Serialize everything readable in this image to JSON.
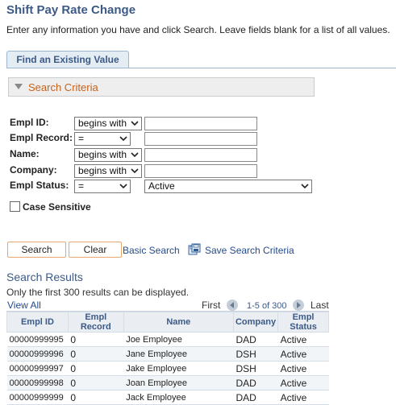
{
  "page": {
    "title": "Shift Pay Rate Change",
    "instructions": "Enter any information you have and click Search. Leave fields blank for a list of all values."
  },
  "tabs": [
    {
      "label": "Find an Existing Value"
    }
  ],
  "search_criteria": {
    "header": "Search Criteria",
    "fields": {
      "empl_id": {
        "label": "Empl ID:",
        "operator": "begins with",
        "value": ""
      },
      "empl_record": {
        "label": "Empl Record:",
        "operator": "=",
        "value": ""
      },
      "name": {
        "label": "Name:",
        "operator": "begins with",
        "value": ""
      },
      "company": {
        "label": "Company:",
        "operator": "begins with",
        "value": ""
      },
      "empl_status": {
        "label": "Empl Status:",
        "operator": "=",
        "value": "Active"
      }
    },
    "case_sensitive": {
      "label": "Case Sensitive",
      "checked": false
    }
  },
  "actions": {
    "search": "Search",
    "clear": "Clear",
    "basic_search": "Basic Search",
    "save_search": "Save Search Criteria"
  },
  "results": {
    "title": "Search Results",
    "note": "Only the first 300 results can be displayed.",
    "view_all": "View All",
    "first": "First",
    "range": "1-5 of 300",
    "last": "Last",
    "columns": [
      "Empl ID",
      "Empl Record",
      "Name",
      "Company",
      "Empl Status"
    ],
    "rows": [
      {
        "empl_id": "00000999995",
        "empl_record": "0",
        "name": "Joe Employee",
        "company": "DAD",
        "status": "Active"
      },
      {
        "empl_id": "00000999996",
        "empl_record": "0",
        "name": "Jane Employee",
        "company": "DSH",
        "status": "Active"
      },
      {
        "empl_id": "00000999997",
        "empl_record": "0",
        "name": "Jake Employee",
        "company": "DSH",
        "status": "Active"
      },
      {
        "empl_id": "00000999998",
        "empl_record": "0",
        "name": "Joan Employee",
        "company": "DAD",
        "status": "Active"
      },
      {
        "empl_id": "00000999999",
        "empl_record": "0",
        "name": "Jack Employee",
        "company": "DAD",
        "status": "Active"
      }
    ]
  },
  "icons": {
    "collapse": "triangle-down-icon",
    "dropdown": "chevron-down-icon",
    "save": "save-criteria-icon",
    "prev": "previous-page-icon",
    "next": "next-page-icon"
  },
  "colors": {
    "title": "#3c5a87",
    "criteria_header": "#c7621a",
    "link": "#254b8c",
    "button_border": "#e6a86c"
  }
}
